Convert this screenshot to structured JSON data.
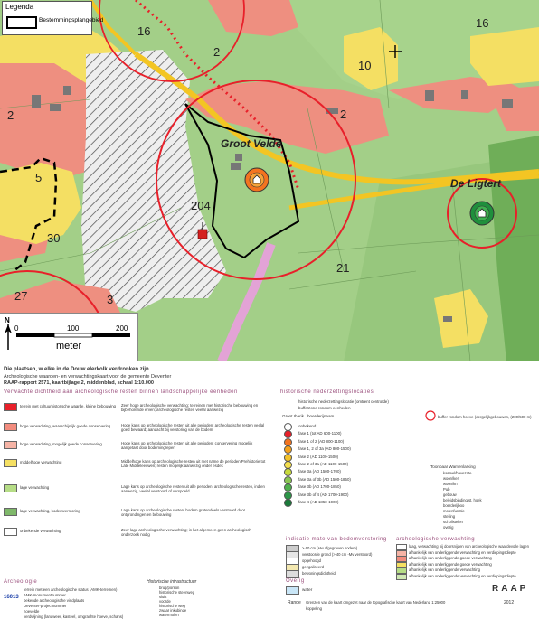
{
  "map": {
    "legend": {
      "title": "Legenda",
      "item": "Bestemmingsplangebied"
    },
    "numbers": [
      "16",
      "2",
      "10",
      "16",
      "2",
      "5",
      "30",
      "204",
      "21",
      "27",
      "3"
    ],
    "places": [
      "Groot Velde",
      "De Ligtert"
    ],
    "scale": {
      "north": "N",
      "ticks": [
        "0",
        "100",
        "200"
      ],
      "unit": "meter"
    }
  },
  "info": {
    "title": "Die plaatsen, w elke in de Douw elerkolk verdronken zijn ...",
    "subtitle1": "Archeologische waarden- en verwachtingskaart voor de gemeente Deventer",
    "subtitle2": "RAAP-rapport 2571, kaartbijlage 2, middenblad, schaal 1:10.000",
    "col1_header": "Verwachte dichtheid aan archeologische resten binnen landschappelijke eenheden",
    "rows": [
      {
        "label": "terrein met cultuurhistorische waarde, kleine bebouwing",
        "color": "#e8202a",
        "desc": "Zeer hoge archeologische verwachting; terreinen met historische bebouwing en bijbehorende erven; archeologische resten veelal aanwezig"
      },
      {
        "label": "hoge verwachting, waarschijnlijk goede conservering",
        "color": "#f28c7e",
        "desc": "Hoge kans op archeologische resten uit alle perioden; archeologische resten veelal goed bewaard; aandacht bij verstoring van de bodem"
      },
      {
        "label": "hoge verwachting, mogelijk goede conservering",
        "color": "#f6b4a6",
        "desc": "Hoge kans op archeologische resten uit alle perioden; conservering mogelijk aangetast door bodemingrepen"
      },
      {
        "label": "middelhoge verwachting",
        "color": "#f5e063",
        "desc": "Middelhoge kans op archeologische resten uit met name de perioden Prehistorie tot Late Middeleeuwen; resten mogelijk aanwezig onder esdek"
      },
      {
        "label": "lage verwachting",
        "color": "#b6dd86",
        "desc": "Lage kans op archeologische resten uit alle perioden; archeologische resten, indien aanwezig, veelal verstoord of verspoeld"
      },
      {
        "label": "lage verwachting, bodemverstoring",
        "color": "#7fb86a",
        "desc": "Lage kans op archeologische resten; bodem grotendeels verstoord door ontgrondingen en bebouwing"
      },
      {
        "label": "onbekende verwachting",
        "color": "#ffffff",
        "desc": "Zeer lage archeologische verwachting; in het algemeen geen archeologisch onderzoek nodig"
      }
    ],
    "archeologie_header": "Archeologie",
    "arch_items": [
      "terrein met een archeologische status (AMK-terreinen)",
      "AMK-monumentnummer",
      "bekende archeologische vindplaats",
      "Deventer-projectnummer",
      "hoevelde",
      "verdwijning (landweer, kasteel, omgrachte hoeve, schans)"
    ],
    "amk_number": "16013",
    "hist_header": "Historische infrastructuur",
    "hist_items": [
      "brug/ponton",
      "historische steenweg",
      "sluis",
      "voorde",
      "historische weg",
      "zwaar inkubinde",
      "watermolen"
    ],
    "col2_header": "historische nederzettingslocaties",
    "col2_items": [
      "historische nederzettingslocatie (omtrent centroïde)",
      "bufferzone rondom eenheden",
      "onbekend",
      "fase 1 (tot AD 600-1100)",
      "fase 1 of 2 (AD 800-1100)",
      "fase 1, 2 of 3a (AD 800-1500)",
      "fase 2 (AD 1100-1500)",
      "fase 2 of 3a (AD 1100-1500)",
      "fase 3a (AD 1500-1700)",
      "fase 3a of 3b (AD 1500-1850)",
      "fase 3b (AD 1700-1850)",
      "fase 3b of 4 (AD 1700-1900)",
      "fase 4 (AD 1850-1900)"
    ],
    "phase_colors": [
      "#ffffff",
      "#e8202a",
      "#f37420",
      "#f4a11c",
      "#f2c22a",
      "#f4df4e",
      "#c8da3c",
      "#8ac653",
      "#4fb04c",
      "#2c9648",
      "#1a7a3a"
    ],
    "gf_label": "Groot Ibarik",
    "gf_label2": "boerderijnaam",
    "feature_header": "Toonbaar Wamenlarking",
    "features": [
      "kasteel/havezate",
      "woon/ker",
      "woon/kn",
      "Pub",
      "gebouw",
      "beleidsbinding/st, hoek",
      "boerderijboo",
      "molenfunctie",
      "stelling",
      "schollstelen",
      "overig"
    ],
    "buffer_label": "buffer rondom hoeve (dergelijkgebouwen, (200/500 m)",
    "indicatie_header": "indicatie mate van bodemverstoring",
    "indicatie_items": [
      "> 60 cm (Hw afgegraven bodem)",
      "verstoorde grond (> 40 cm -Mv verstoord)",
      "opgehoogd",
      "geëgaliseerd",
      "bewoningsdichtheid"
    ],
    "verw_header": "archeologische verwachting",
    "verw_items": [
      "laag, verwachting bij doorsnijden van archeologische waardevolle lagen",
      "afhankelijk van onderliggende verwachting en verdiepingsdiepte",
      "afhankelijk van onderliggende goede verwachting",
      "afhankelijk van onderliggende goede verwachting",
      "afhankelijk van onderliggende verwachting",
      "afhankelijk van onderliggende verwachting en verdiepingsdiepte"
    ],
    "overig_header": "Overig",
    "overig_items": [
      "water",
      "koppeling"
    ],
    "rande_label": "Rande",
    "rande_text": "Grenzen van de kaart omgezet naar de topografische kaart van Nederland 1:25000",
    "org": "RAAP",
    "year": "2012"
  }
}
